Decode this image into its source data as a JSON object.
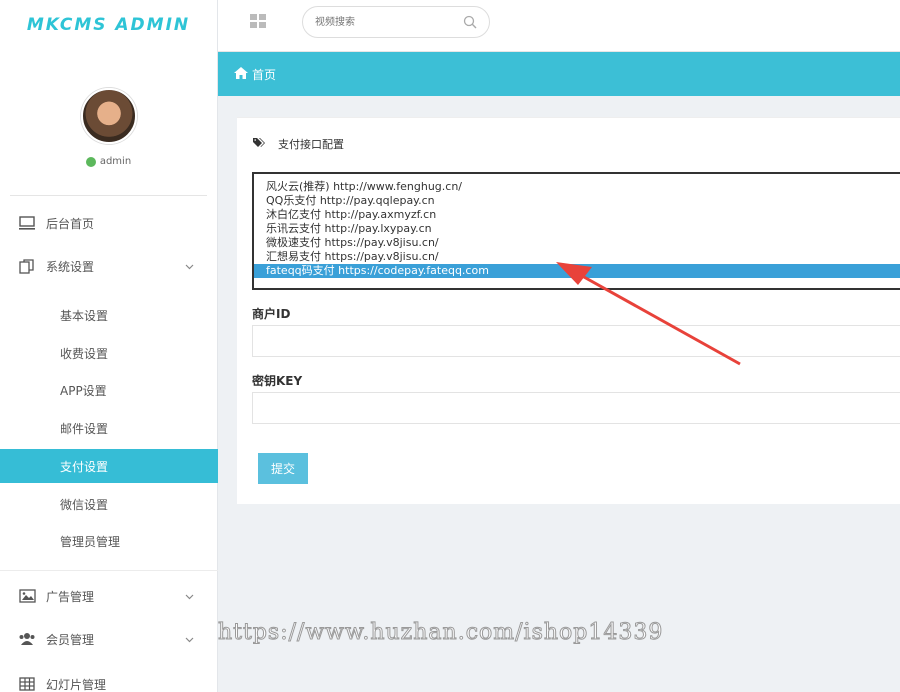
{
  "app": {
    "logo_text": "MKCMS ADMIN"
  },
  "user": {
    "name": "admin",
    "status_color": "#5cb85c"
  },
  "search": {
    "placeholder": "视频搜索"
  },
  "breadcrumb": {
    "home_label": "首页"
  },
  "sidebar": {
    "items": [
      {
        "label": "后台首页",
        "icon": "monitor-icon"
      },
      {
        "label": "系统设置",
        "icon": "copy-icon",
        "expanded": true,
        "children": [
          {
            "label": "基本设置"
          },
          {
            "label": "收费设置"
          },
          {
            "label": "APP设置"
          },
          {
            "label": "邮件设置"
          },
          {
            "label": "支付设置",
            "active": true
          },
          {
            "label": "微信设置"
          },
          {
            "label": "管理员管理"
          }
        ]
      },
      {
        "label": "广告管理",
        "icon": "image-icon"
      },
      {
        "label": "会员管理",
        "icon": "users-icon"
      },
      {
        "label": "幻灯片管理",
        "icon": "table-icon"
      }
    ]
  },
  "panel": {
    "title": "支付接口配置",
    "options": [
      "风火云(推荐) http://www.fenghug.cn/",
      "QQ乐支付 http://pay.qqlepay.cn",
      "沐白亿支付 http://pay.axmyzf.cn",
      "乐讯云支付 http://pay.lxypay.cn",
      "微极速支付 https://pay.v8jisu.cn/",
      "汇想易支付 https://pay.v8jisu.cn/",
      "fateqq码支付 https://codepay.fateqq.com"
    ],
    "selected_option": "fateqq码支付 https://codepay.fateqq.com",
    "merchant_id_label": "商户ID",
    "merchant_id_value": "",
    "secret_key_label": "密钥KEY",
    "secret_key_value": "",
    "submit_label": "提交"
  },
  "watermark": "https://www.huzhan.com/ishop14339",
  "colors": {
    "accent": "#3cbfd6",
    "active_menu": "#36bdd6",
    "selected_option": "#3aa0d8",
    "arrow": "#e8423a"
  }
}
